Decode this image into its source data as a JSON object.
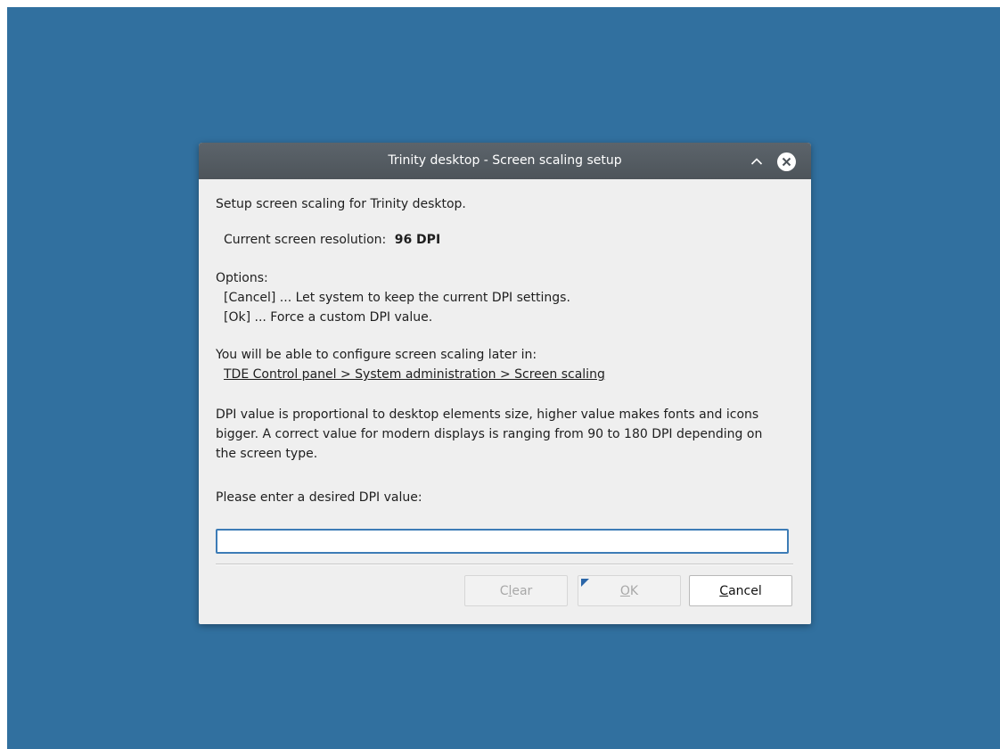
{
  "window": {
    "title": "Trinity desktop - Screen scaling setup"
  },
  "content": {
    "intro": "Setup screen scaling for Trinity desktop.",
    "resolution_label": "Current screen resolution:",
    "resolution_value": "96 DPI",
    "options_heading": "Options:",
    "option_cancel": "[Cancel] ... Let system to keep the current DPI settings.",
    "option_ok": "[Ok] ... Force a custom DPI value.",
    "later_text": "You will be able to configure screen scaling later in:",
    "control_panel_path": "TDE Control panel > System administration > Screen scaling",
    "description": "DPI value is proportional to desktop elements size, higher value makes fonts and icons bigger. A correct value for modern displays is ranging from 90 to 180 DPI depending on the screen type.",
    "prompt": "Please enter a desired DPI value:",
    "dpi_input_value": ""
  },
  "buttons": {
    "clear": {
      "pre": "C",
      "mnemonic": "l",
      "post": "ear"
    },
    "ok": {
      "pre": "",
      "mnemonic": "O",
      "post": "K"
    },
    "cancel": {
      "pre": "",
      "mnemonic": "C",
      "post": "ancel"
    }
  },
  "icons": {
    "shade": "chevron-up-icon",
    "close": "close-circle-icon"
  },
  "colors": {
    "desktop_background": "#31709f",
    "titlebar": "#555c62",
    "dialog_background": "#efefef",
    "input_focus_border": "#3d7cb6"
  }
}
